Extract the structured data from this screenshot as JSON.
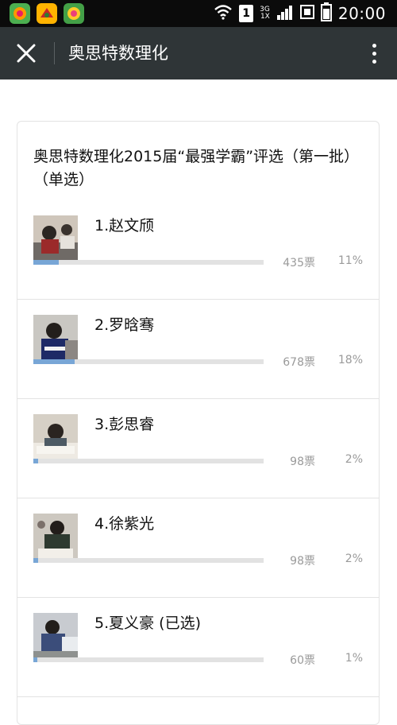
{
  "status_bar": {
    "time": "20:00",
    "sim_slot": "1",
    "network_top": "3G",
    "network_bottom": "1X",
    "icons": [
      "app-icon-1",
      "app-icon-2",
      "app-icon-3",
      "wifi-icon",
      "sim-icon",
      "signal-icon",
      "data-icon",
      "battery-icon"
    ]
  },
  "header": {
    "title": "奥思特数理化",
    "close_icon": "close-icon",
    "more_icon": "more-vertical-icon"
  },
  "poll": {
    "title": "奥思特数理化2015届“最强学霸”评选（第一批）（单选）",
    "options": [
      {
        "label": "1.赵文颀",
        "votes": "435票",
        "percent": "11%",
        "fraction": 0.11
      },
      {
        "label": "2.罗晗骞",
        "votes": "678票",
        "percent": "18%",
        "fraction": 0.18
      },
      {
        "label": "3.彭思睿",
        "votes": "98票",
        "percent": "2%",
        "fraction": 0.02
      },
      {
        "label": "4.徐紫光",
        "votes": "98票",
        "percent": "2%",
        "fraction": 0.02
      },
      {
        "label": "5.夏义豪 (已选)",
        "votes": "60票",
        "percent": "1%",
        "fraction": 0.01
      }
    ]
  },
  "colors": {
    "status_bar_bg": "#0b0b0b",
    "title_bar_bg": "#2f3537",
    "progress_fill": "#78a6d6",
    "progress_track": "#e2e2e2",
    "muted_text": "#9a9a9a"
  }
}
